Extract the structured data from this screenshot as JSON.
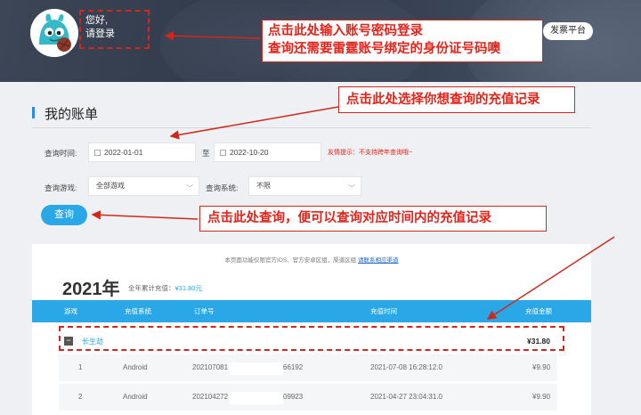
{
  "header": {
    "greeting_line1": "您好,",
    "greeting_line2": "请登录",
    "invoice_button": "发票平台"
  },
  "annotations": {
    "login_note_line1": "点击此处输入账号密码登录",
    "login_note_line2": "查询还需要雷霆账号绑定的身份证号码噢",
    "select_note": "点击此处选择你想查询的充值记录",
    "query_note": "点击此处查询，便可以查询对应时间内的充值记录"
  },
  "section": {
    "title": "我的账单"
  },
  "filters": {
    "time_label": "查询时间:",
    "start_date": "2022-01-01",
    "to_label": "至",
    "end_date": "2022-10-20",
    "tip": "友情提示：不支持跨年查询哦~",
    "game_label": "查询游戏:",
    "game_value": "全部游戏",
    "system_label": "查询系统:",
    "system_value": "不限",
    "query_button": "查询"
  },
  "results": {
    "notice_text": "本页面功能仅限官方IOS、官方安卓区组，渠道区组 ",
    "notice_link": "请联系相应渠道",
    "year": "2021年",
    "year_sum_label": "全年累计充值：",
    "year_sum_value": "¥31.80元",
    "columns": [
      "游戏",
      "充值系统",
      "订单号",
      "充值时间",
      "充值金额"
    ],
    "group": {
      "minus": "−",
      "game": "长生劫",
      "total": "¥31.80"
    },
    "rows": [
      {
        "index": "1",
        "system": "Android",
        "order_prefix": "202107081",
        "order_suffix": "66192",
        "time": "2021-07-08 16:28:12.0",
        "amount": "¥9.90"
      },
      {
        "index": "2",
        "system": "Android",
        "order_prefix": "202104272",
        "order_suffix": "09923",
        "time": "2021-04-27 23:04:31.0",
        "amount": "¥9.90"
      }
    ]
  },
  "colors": {
    "accent": "#2aa7e6",
    "annotation": "#e2241a",
    "banner": "#343d4d"
  }
}
